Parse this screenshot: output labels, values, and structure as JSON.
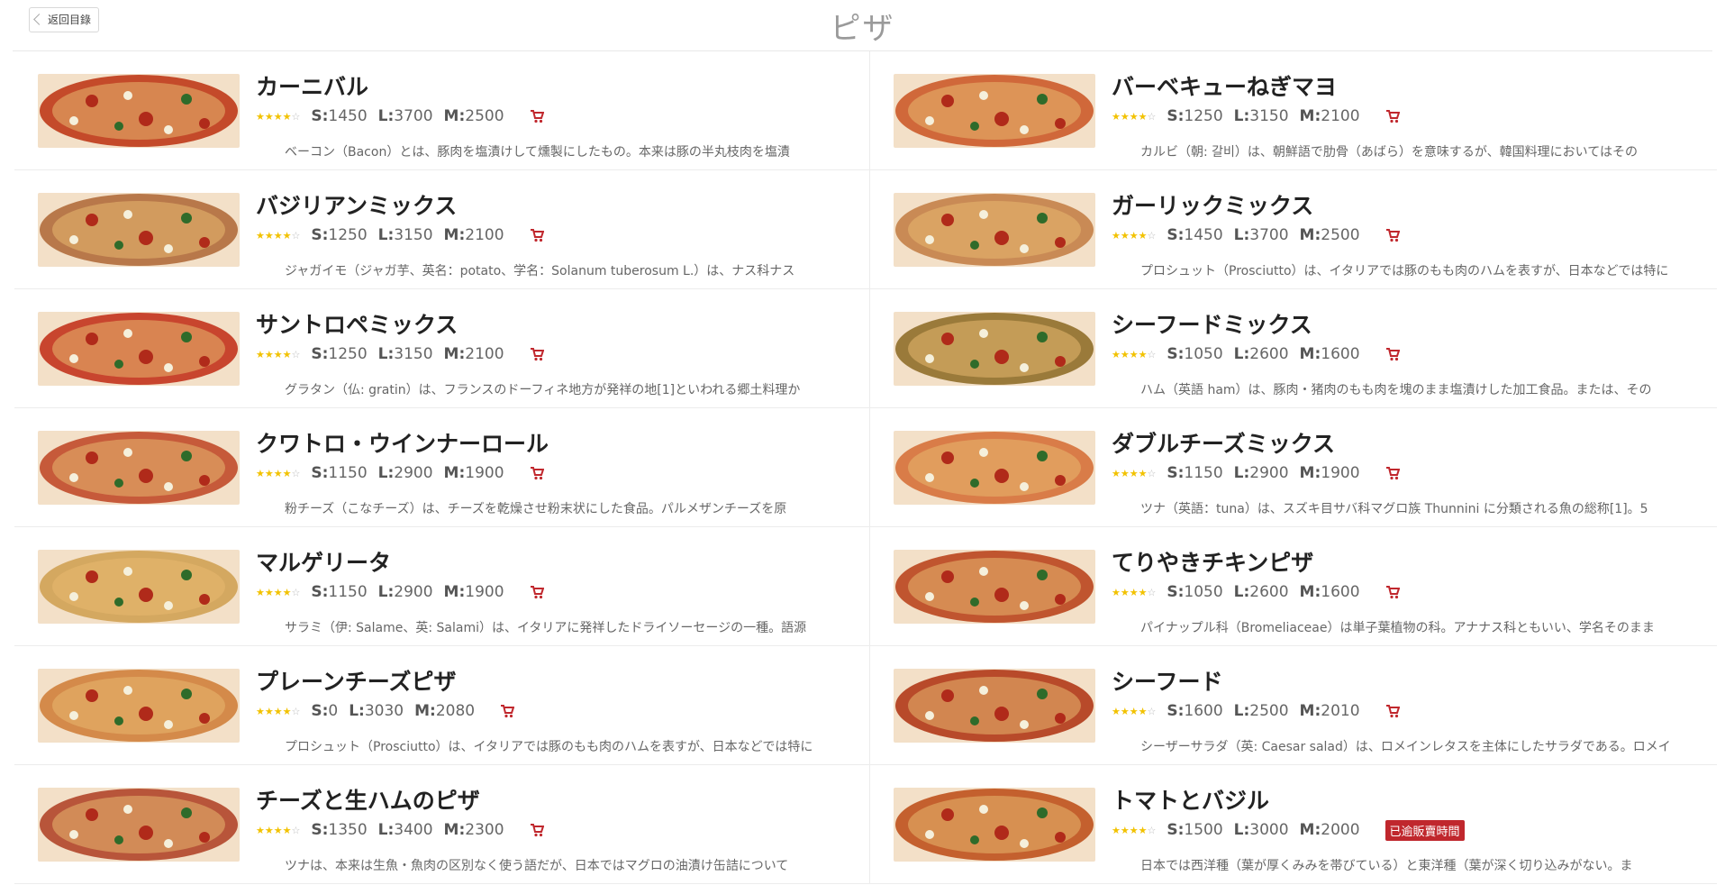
{
  "header": {
    "back_label": "返回目錄",
    "title": "ピザ"
  },
  "items": [
    {
      "name": "カーニバル",
      "s": "S:1450",
      "l": "L:3700",
      "m": "M:2500",
      "desc": "ベーコン（Bacon）とは、豚肉を塩漬けして燻製にしたもの。本来は豚の半丸枝肉を塩漬",
      "badge": "",
      "img": "#c44a2a"
    },
    {
      "name": "バーベキューねぎマヨ",
      "s": "S:1250",
      "l": "L:3150",
      "m": "M:2100",
      "desc": "カルビ（朝: 갈비）は、朝鮮語で肋骨（あばら）を意味するが、韓国料理においてはその",
      "badge": "",
      "img": "#d0683a"
    },
    {
      "name": "バジリアンミックス",
      "s": "S:1250",
      "l": "L:3150",
      "m": "M:2100",
      "desc": "ジャガイモ（ジャガ芋、英名：potato、学名：Solanum tuberosum L.）は、ナス科ナス",
      "badge": "",
      "img": "#b8784a"
    },
    {
      "name": "ガーリックミックス",
      "s": "S:1450",
      "l": "L:3700",
      "m": "M:2500",
      "desc": "プロシュット（Prosciutto）は、イタリアでは豚のもも肉のハムを表すが、日本などでは特に",
      "badge": "",
      "img": "#c98a55"
    },
    {
      "name": "サントロペミックス",
      "s": "S:1250",
      "l": "L:3150",
      "m": "M:2100",
      "desc": "グラタン（仏: gratin）は、フランスのドーフィネ地方が発祥の地[1]といわれる郷土料理か",
      "badge": "",
      "img": "#c8452e"
    },
    {
      "name": "シーフードミックス",
      "s": "S:1050",
      "l": "L:2600",
      "m": "M:1600",
      "desc": "ハム（英語 ham）は、豚肉・猪肉のもも肉を塊のまま塩漬けした加工食品。または、その",
      "badge": "",
      "img": "#9a7a3a"
    },
    {
      "name": "クワトロ・ウインナーロール",
      "s": "S:1150",
      "l": "L:2900",
      "m": "M:1900",
      "desc": "粉チーズ（こなチーズ）は、チーズを乾燥させ粉末状にした食品。パルメザンチーズを原",
      "badge": "",
      "img": "#c65a3a"
    },
    {
      "name": "ダブルチーズミックス",
      "s": "S:1150",
      "l": "L:2900",
      "m": "M:1900",
      "desc": "ツナ（英語：tuna）は、スズキ目サバ科マグロ族 Thunnini に分類される魚の総称[1]。5",
      "badge": "",
      "img": "#d97c48"
    },
    {
      "name": "マルゲリータ",
      "s": "S:1150",
      "l": "L:2900",
      "m": "M:1900",
      "desc": "サラミ（伊: Salame、英: Salami）は、イタリアに発祥したドライソーセージの一種。語源",
      "badge": "",
      "img": "#d4a860"
    },
    {
      "name": "てりやきチキンピザ",
      "s": "S:1050",
      "l": "L:2600",
      "m": "M:1600",
      "desc": "パイナップル科（Bromeliaceae）は単子葉植物の科。アナナス科ともいい、学名そのまま",
      "badge": "",
      "img": "#c0552f"
    },
    {
      "name": "プレーンチーズピザ",
      "s": "S:0",
      "l": "L:3030",
      "m": "M:2080",
      "desc": "プロシュット（Prosciutto）は、イタリアでは豚のもも肉のハムを表すが、日本などでは特に",
      "badge": "",
      "img": "#d48a4a"
    },
    {
      "name": "シーフード",
      "s": "S:1600",
      "l": "L:2500",
      "m": "M:2010",
      "desc": "シーザーサラダ（英: Caesar salad）は、ロメインレタスを主体にしたサラダである。ロメイ",
      "badge": "",
      "img": "#b84a2a"
    },
    {
      "name": "チーズと生ハムのピザ",
      "s": "S:1350",
      "l": "L:3400",
      "m": "M:2300",
      "desc": "ツナは、本来は生魚・魚肉の区別なく使う語だが、日本ではマグロの油漬け缶詰について",
      "badge": "",
      "img": "#b8553a"
    },
    {
      "name": "トマトとバジル",
      "s": "S:1500",
      "l": "L:3000",
      "m": "M:2000",
      "desc": "日本では西洋種（葉が厚くみみを帯びている）と東洋種（葉が深く切り込みがない。ま",
      "badge": "已逾販賣時間",
      "img": "#c4602e"
    }
  ],
  "colors": {
    "title": "#9a9a9a",
    "cart": "#c0272d",
    "star": "#f2c200"
  },
  "icons": {
    "cart": "shopping-cart-icon",
    "back": "chevron-left-icon",
    "rating": "star-icon"
  }
}
